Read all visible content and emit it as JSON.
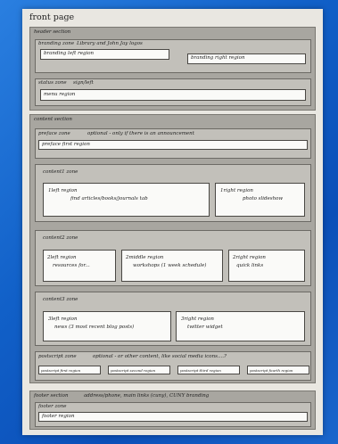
{
  "title": "front page",
  "header": {
    "label": "header section",
    "branding_zone": {
      "label": "branding zone",
      "note": "Library and John Jay logos",
      "left": "branding left region",
      "right": "branding right region"
    },
    "status_zone": {
      "label": "status zone",
      "note": "sign/left",
      "menu": "menu region"
    }
  },
  "content": {
    "label": "content section",
    "preface": {
      "label": "preface zone",
      "note": "optional - only if there is an announcement",
      "region": "preface first region"
    },
    "content1": {
      "label": "content1 zone",
      "left_title": "1left region",
      "left_text": "find articles/books/journals tab",
      "right_title": "1right region",
      "right_text": "photo slideshow"
    },
    "content2": {
      "label": "content2 zone",
      "left_title": "2left region",
      "left_text": "resources for...",
      "mid_title": "2middle region",
      "mid_text": "workshops (1 week schedule)",
      "right_title": "2right region",
      "right_text": "quick links"
    },
    "content3": {
      "label": "content3 zone",
      "left_title": "3left region",
      "left_text": "news (3 most recent blog posts)",
      "right_title": "3right region",
      "right_text": "twitter widget"
    },
    "postscript": {
      "label": "postscript zone",
      "note": "optional - or other content, like social media icons....?",
      "r1": "postscript first region",
      "r2": "postscript second region",
      "r3": "postscript third region",
      "r4": "postscript fourth region"
    }
  },
  "footer": {
    "label": "footer section",
    "note": "address/phone, main links (cuny), CUNY branding",
    "zone_label": "footer zone",
    "region": "footer region"
  }
}
